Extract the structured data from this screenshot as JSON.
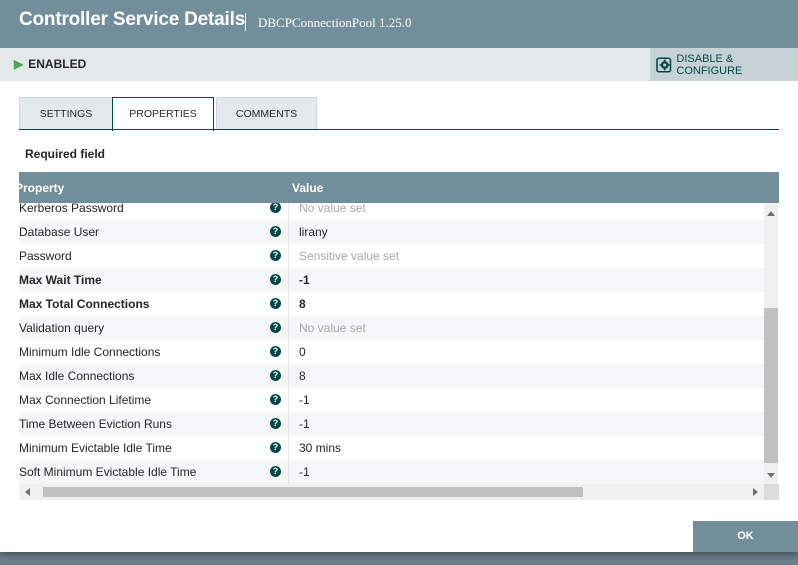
{
  "dialog": {
    "title": "Controller Service Details",
    "subtitle": "DBCPConnectionPool 1.25.0"
  },
  "status": {
    "label": "ENABLED",
    "icon": "play-icon",
    "color": "#4ca55a"
  },
  "toolbar": {
    "disable_configure_label": "DISABLE & CONFIGURE",
    "icon": "gear-icon"
  },
  "tabs": [
    {
      "label": "SETTINGS",
      "active": false
    },
    {
      "label": "PROPERTIES",
      "active": true
    },
    {
      "label": "COMMENTS",
      "active": false
    }
  ],
  "required_field_label": "Required field",
  "table": {
    "columns": [
      "Property",
      "Value"
    ],
    "rows": [
      {
        "name": "Kerberos Password",
        "value": "No value set",
        "required": false,
        "value_style": "muted"
      },
      {
        "name": "Database User",
        "value": "lirany",
        "required": false,
        "value_style": "normal"
      },
      {
        "name": "Password",
        "value": "Sensitive value set",
        "required": false,
        "value_style": "muted"
      },
      {
        "name": "Max Wait Time",
        "value": "-1",
        "required": true,
        "value_style": "bold"
      },
      {
        "name": "Max Total Connections",
        "value": "8",
        "required": true,
        "value_style": "bold"
      },
      {
        "name": "Validation query",
        "value": "No value set",
        "required": false,
        "value_style": "muted"
      },
      {
        "name": "Minimum Idle Connections",
        "value": "0",
        "required": false,
        "value_style": "normal"
      },
      {
        "name": "Max Idle Connections",
        "value": "8",
        "required": false,
        "value_style": "normal"
      },
      {
        "name": "Max Connection Lifetime",
        "value": "-1",
        "required": false,
        "value_style": "normal"
      },
      {
        "name": "Time Between Eviction Runs",
        "value": "-1",
        "required": false,
        "value_style": "normal"
      },
      {
        "name": "Minimum Evictable Idle Time",
        "value": "30 mins",
        "required": false,
        "value_style": "normal"
      },
      {
        "name": "Soft Minimum Evictable Idle Time",
        "value": "-1",
        "required": false,
        "value_style": "normal"
      }
    ],
    "help_icon": "help-icon",
    "help_glyph": "?"
  },
  "footer": {
    "ok_label": "OK"
  },
  "colors": {
    "header_bg": "#728e9b",
    "accent": "#004849"
  }
}
